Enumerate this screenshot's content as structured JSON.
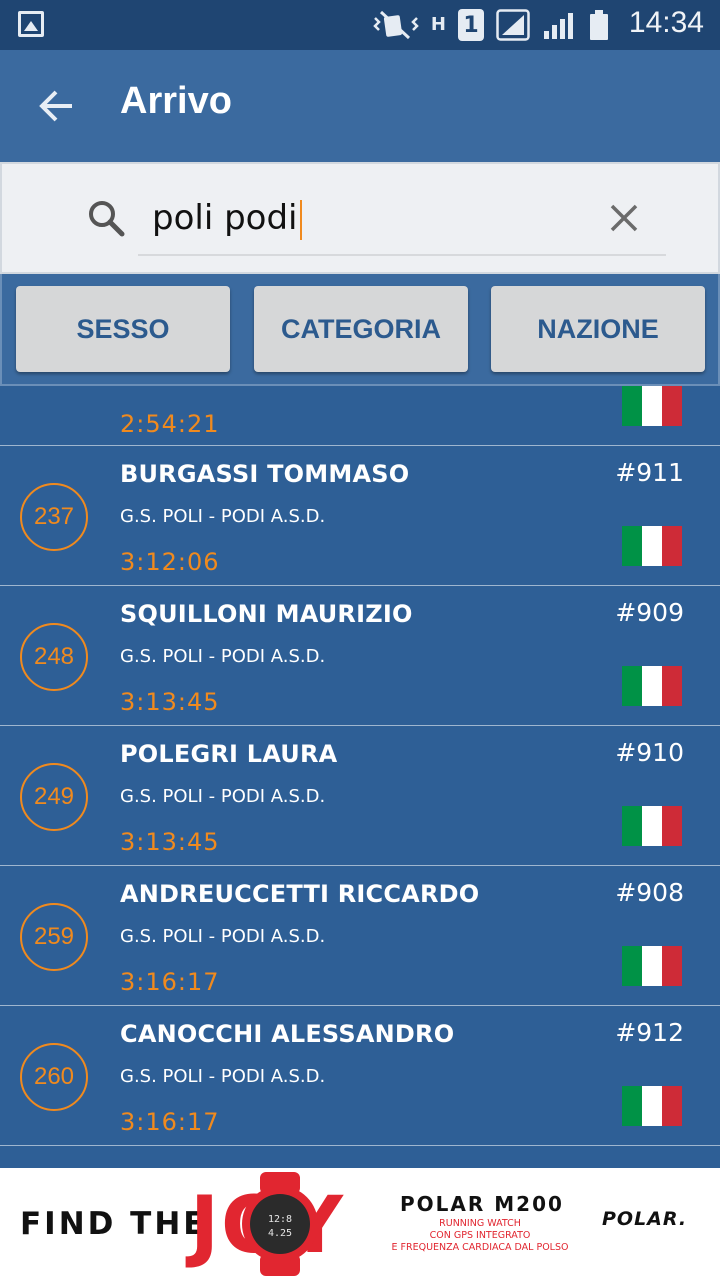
{
  "status_bar": {
    "time": "14:34",
    "icons": [
      "gallery-icon",
      "vibrate-muted-icon",
      "h-plus-data-icon",
      "sim-1-icon",
      "signal-1-icon",
      "signal-2-icon",
      "battery-icon"
    ],
    "sim_label": "1",
    "network_label": "H"
  },
  "app_bar": {
    "title": "Arrivo",
    "back_icon": "arrow-left-icon"
  },
  "search": {
    "value": "poli podi",
    "search_icon": "magnifier-icon",
    "clear_icon": "close-icon"
  },
  "filters": [
    {
      "label": "SESSO"
    },
    {
      "label": "CATEGORIA"
    },
    {
      "label": "NAZIONE"
    }
  ],
  "results": {
    "partial_row": {
      "time": "2:54:21",
      "flag_colors": [
        "#009246",
        "#ffffff",
        "#ce2b37"
      ]
    },
    "rows": [
      {
        "position": "237",
        "name": "BURGASSI TOMMASO",
        "team": "G.S. POLI - PODI A.S.D.",
        "time": "3:12:06",
        "bib": "#911"
      },
      {
        "position": "248",
        "name": "SQUILLONI MAURIZIO",
        "team": "G.S. POLI - PODI A.S.D.",
        "time": "3:13:45",
        "bib": "#909"
      },
      {
        "position": "249",
        "name": "POLEGRI LAURA",
        "team": "G.S. POLI - PODI A.S.D.",
        "time": "3:13:45",
        "bib": "#910"
      },
      {
        "position": "259",
        "name": "ANDREUCCETTI RICCARDO",
        "team": "G.S. POLI - PODI A.S.D.",
        "time": "3:16:17",
        "bib": "#908"
      },
      {
        "position": "260",
        "name": "CANOCCHI ALESSANDRO",
        "team": "G.S. POLI - PODI A.S.D.",
        "time": "3:16:17",
        "bib": "#912"
      }
    ]
  },
  "ad": {
    "headline": "FIND THE",
    "headline_big": "JOY",
    "product": "POLAR M200",
    "sub_line_1": "RUNNING WATCH",
    "sub_line_2": "CON GPS INTEGRATO",
    "sub_line_3": "E FREQUENZA CARDIACA DAL POLSO",
    "brand": "POLAR.",
    "watch_display_1": "12:8",
    "watch_display_2": "4.25"
  },
  "colors": {
    "accent": "#f08a1e",
    "list_bg": "#2e5f96",
    "app_bar": "#3b6a9f",
    "status_bar": "#1f4572",
    "filter_text": "#2c5a8e",
    "ad_red": "#e12630"
  }
}
